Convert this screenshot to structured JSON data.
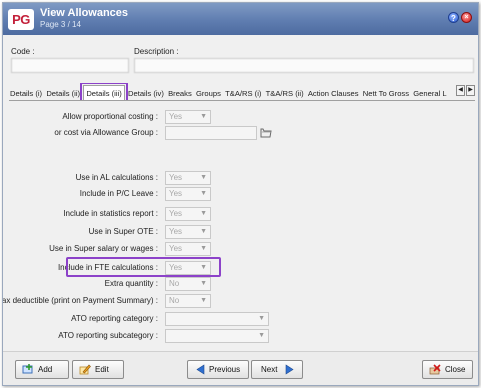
{
  "window": {
    "logo": "PG",
    "title": "View Allowances",
    "subtitle": "Page 3 / 14",
    "help_glyph": "?",
    "close_glyph": "×"
  },
  "header": {
    "code_label": "Code :",
    "description_label": "Description :"
  },
  "tabs": [
    {
      "label": "Details (i)",
      "active": false
    },
    {
      "label": "Details (ii)",
      "active": false
    },
    {
      "label": "Details (iii)",
      "active": true
    },
    {
      "label": "Details (iv)",
      "active": false
    },
    {
      "label": "Breaks",
      "active": false
    },
    {
      "label": "Groups",
      "active": false
    },
    {
      "label": "T&A/RS (i)",
      "active": false
    },
    {
      "label": "T&A/RS (ii)",
      "active": false
    },
    {
      "label": "Action Clauses",
      "active": false
    },
    {
      "label": "Nett To Gross",
      "active": false
    },
    {
      "label": "General L",
      "active": false
    }
  ],
  "tab_nav": {
    "left": "◀",
    "right": "▶"
  },
  "form": {
    "proportional_costing": {
      "label": "Allow proportional costing :",
      "value": "Yes"
    },
    "cost_via_group": {
      "label": "or cost via Allowance Group :",
      "value": ""
    },
    "al_calc": {
      "label": "Use in AL calculations :",
      "value": "Yes"
    },
    "pc_leave": {
      "label": "Include in P/C Leave :",
      "value": "Yes"
    },
    "stats_report": {
      "label": "Include in statistics report :",
      "value": "Yes"
    },
    "super_ote": {
      "label": "Use in Super OTE :",
      "value": "Yes"
    },
    "super_salary": {
      "label": "Use in Super salary or wages :",
      "value": "Yes"
    },
    "fte_calc": {
      "label": "Include in FTE calculations :",
      "value": "Yes"
    },
    "extra_quantity": {
      "label": "Extra quantity :",
      "value": "No"
    },
    "tax_deductible": {
      "label": "Tax deductible (print on Payment Summary) :",
      "value": "No"
    },
    "ato_category": {
      "label": "ATO reporting category :",
      "value": ""
    },
    "ato_subcategory": {
      "label": "ATO reporting subcategory :",
      "value": ""
    }
  },
  "buttons": {
    "add": "Add",
    "edit": "Edit",
    "previous": "Previous",
    "next": "Next",
    "close": "Close"
  },
  "colors": {
    "titlebar": "#5f7db0",
    "highlight": "#8c42c9",
    "logo_text": "#c3203a"
  }
}
